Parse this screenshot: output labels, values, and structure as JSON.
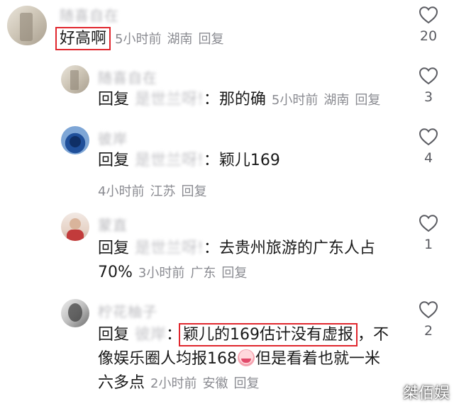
{
  "comments": [
    {
      "username": "随喜自在",
      "text": "好高啊",
      "time": "5小时前",
      "location": "湖南",
      "reply_label": "回复",
      "likes": "20"
    },
    {
      "username": "随喜自在",
      "prefix": "回复",
      "mention": "是世兰呀!",
      "sep": "：",
      "text": "那的确",
      "time": "5小时前",
      "location": "湖南",
      "reply_label": "回复",
      "likes": "3"
    },
    {
      "username": "彼岸",
      "prefix": "回复",
      "mention": "是世兰呀!",
      "sep": "：",
      "text": "颖儿169",
      "time": "4小时前",
      "location": "江苏",
      "reply_label": "回复",
      "likes": "4"
    },
    {
      "username": "蒙直",
      "prefix": "回复",
      "mention": "是世兰呀!",
      "sep": "：",
      "text_line1": "去贵州旅游的广东人占",
      "text_line2": "70%",
      "time": "3小时前",
      "location": "广东",
      "reply_label": "回复",
      "likes": "1"
    },
    {
      "username": "柠花柚子",
      "prefix": "回复",
      "mention": "彼岸",
      "sep": "：",
      "highlight": "颖儿的169估计没有虚报",
      "text_after": "，不",
      "text_line2_a": "像娱乐圈人均报168",
      "text_line2_b": "但是看着也就一米",
      "text_line3": "六多点",
      "time": "2小时前",
      "location": "安徽",
      "reply_label": "回复",
      "likes": "2"
    }
  ],
  "watermark": "桀佰娱",
  "colors": {
    "highlight_border": "#e0262d",
    "meta_text": "#8a8b91",
    "body_text": "#1a1a1a"
  },
  "icons": {
    "like": "heart-outline-icon",
    "emoji": "crying-laughing-emoji-icon"
  }
}
